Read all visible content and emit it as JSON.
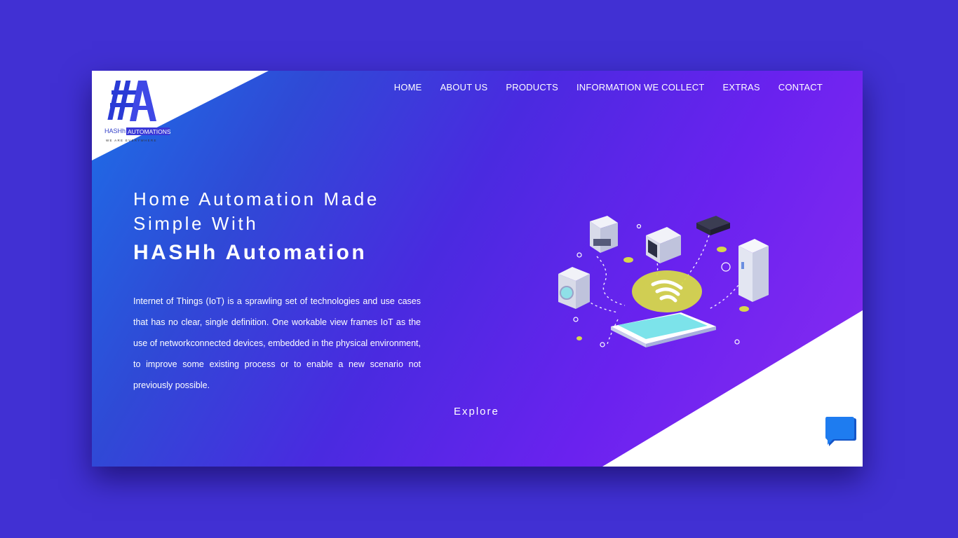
{
  "brand": {
    "logo_mark": "#A",
    "logo_name_left": "HASHh",
    "logo_name_right": "AUTOMATIONS",
    "logo_tagline": "WE ARE EVERYWHERE"
  },
  "nav": {
    "items": [
      {
        "label": "HOME"
      },
      {
        "label": "ABOUT US"
      },
      {
        "label": "PRODUCTS"
      },
      {
        "label": "INFORMATION WE COLLECT"
      },
      {
        "label": "EXTRAS"
      },
      {
        "label": "CONTACT"
      }
    ]
  },
  "hero": {
    "title_line1": "Home Automation Made",
    "title_line2": "Simple With",
    "brand_line": "HASHh Automation",
    "description": "Internet of Things (IoT) is a sprawling set of technologies and use cases that has no clear, single definition. One workable view frames IoT as the use of networkconnected devices, embedded in the physical environment, to improve some existing process or to enable a new scenario not previously possible.",
    "cta_label": "Explore"
  },
  "icons": {
    "chat": "chat-bubble-icon",
    "illustration": "smart-home-iot-illustration"
  },
  "colors": {
    "page_bg": "#4130d3",
    "gradient_start": "#1d6fe8",
    "gradient_end": "#8a2cf2",
    "accent_yellow": "#d6d84a",
    "chat_blue": "#1e7cf0"
  }
}
